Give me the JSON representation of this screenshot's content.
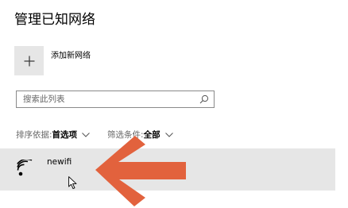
{
  "page": {
    "title": "管理已知网络"
  },
  "add_network": {
    "icon": "plus-icon",
    "label": "添加新网络"
  },
  "search": {
    "placeholder": "搜索此列表",
    "value": "",
    "icon": "search-icon"
  },
  "filters": {
    "sort_label": "排序依据:",
    "sort_value": "首选项",
    "filter_label": "筛选条件:",
    "filter_value": "全部"
  },
  "networks": [
    {
      "name": "newifi",
      "icon": "wifi-icon"
    }
  ],
  "annotation": {
    "arrow_color": "#e2623d",
    "icon": "arrow-left-annotation"
  }
}
